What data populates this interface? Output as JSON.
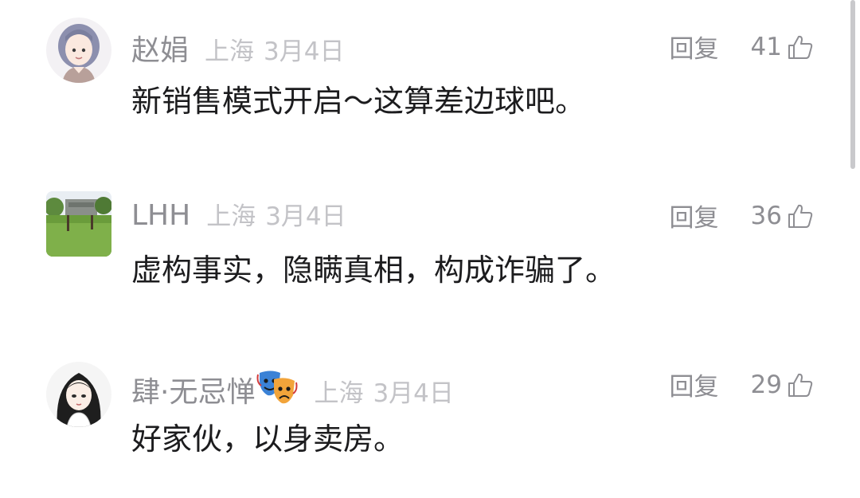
{
  "comments": [
    {
      "username": "赵娟",
      "location": "上海",
      "date": "3月4日",
      "reply_label": "回复",
      "likes": "41",
      "text": "新销售模式开启～这算差边球吧。",
      "avatar": "cartoon-woman-avatar"
    },
    {
      "username": "LHH",
      "location": "上海",
      "date": "3月4日",
      "reply_label": "回复",
      "likes": "36",
      "text": "虚构事实，隐瞒真相，构成诈骗了。",
      "avatar": "landscape-photo-avatar"
    },
    {
      "username": "肆·无忌惮",
      "location": "上海",
      "date": "3月4日",
      "reply_label": "回复",
      "likes": "29",
      "text": "好家伙，以身卖房。",
      "avatar": "cartoon-girl-avatar",
      "badge": "performing-arts-masks-emoji"
    }
  ],
  "colors": {
    "username": "#8e8e93",
    "meta": "#c3c3c7",
    "text": "#1c1c1e"
  }
}
